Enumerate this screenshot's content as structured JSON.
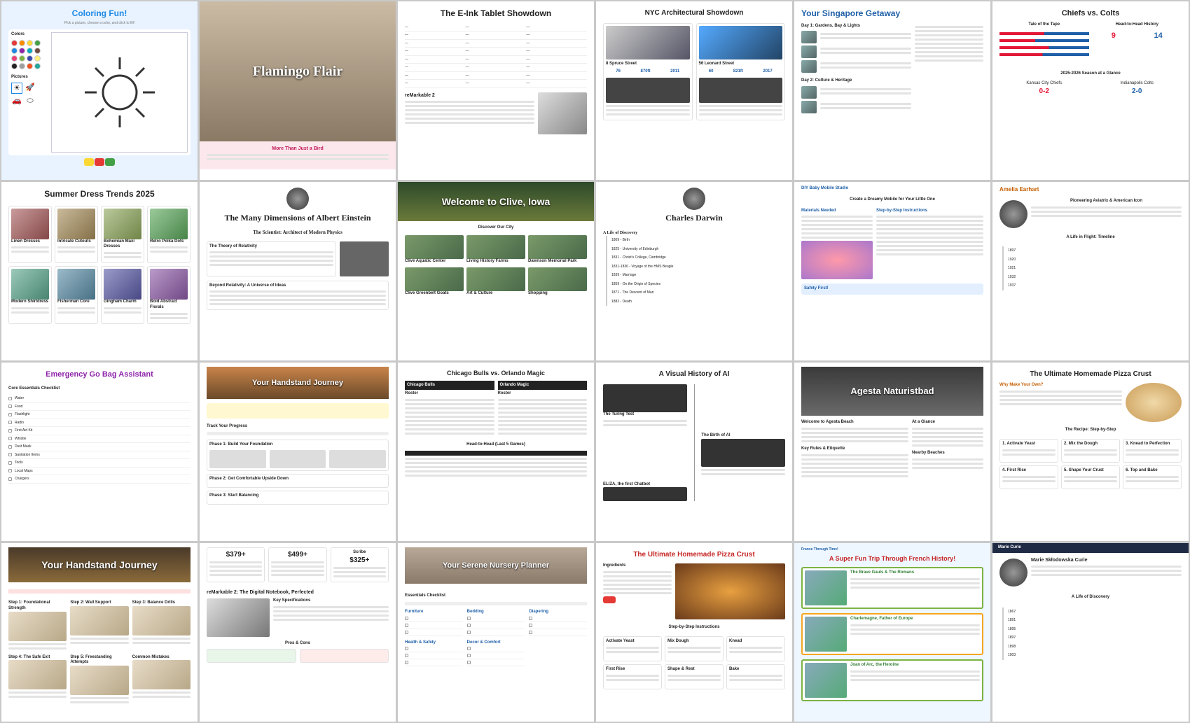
{
  "tiles": [
    {
      "title": "Coloring Fun!",
      "sub": "Pick a picture, choose a color, and click to fill!",
      "colors_label": "Colors",
      "pictures_label": "Pictures"
    },
    {
      "title": "Flamingo Flair",
      "sub": "More Than Just a Bird"
    },
    {
      "title": "The E-Ink Tablet Showdown",
      "sub": "reMarkable 2"
    },
    {
      "title": "NYC Architectural Showdown",
      "sub": "8 Spruce Street",
      "sub2": "56 Leonard Street",
      "n1": "76",
      "n2": "870ft",
      "n3": "2011",
      "n4": "60",
      "n5": "821ft",
      "n6": "2017"
    },
    {
      "title": "Your Singapore Getaway",
      "sub": "Day 1: Gardens, Bay & Lights",
      "sub2": "Day 2: Culture & Heritage"
    },
    {
      "title": "Chiefs vs. Colts",
      "sub": "Tale of the Tape",
      "sub2": "Head-to-Head History",
      "sub3": "2025-2026 Season at a Glance",
      "s1": "9",
      "s2": "14",
      "r1": "0-2",
      "r2": "2-0",
      "team1": "Kansas City Chiefs",
      "team2": "Indianapolis Colts"
    },
    {
      "title": "Summer Dress Trends 2025",
      "items": [
        "Linen Dresses",
        "Intricate Cutouts",
        "Bohemian Maxi Dresses",
        "Retro Polka Dots",
        "Modern Shirtdress",
        "Fisherman Core",
        "Gingham Charm",
        "Bold Abstract Florals"
      ]
    },
    {
      "title": "The Many Dimensions of Albert Einstein",
      "sub": "The Scientist: Architect of Modern Physics",
      "s1": "The Theory of Relativity",
      "s2": "Beyond Relativity: A Universe of Ideas"
    },
    {
      "title": "Welcome to Clive, Iowa",
      "sub": "Discover Our City",
      "items": [
        "Clive Aquatic Center",
        "Living History Farms",
        "Dawnson Memorial Park",
        "Clive Greenbelt Goats",
        "Art & Culture",
        "Shopping"
      ]
    },
    {
      "title": "Charles Darwin",
      "sub": "A Life of Discovery",
      "items": [
        "1809 - Birth",
        "1825 - University of Edinburgh",
        "1831 - Christ's College, Cambridge",
        "1831-1836 - Voyage of the HMS Beagle",
        "1839 - Marriage",
        "1859 - On the Origin of Species",
        "1871 - The Descent of Man",
        "1882 - Death"
      ]
    },
    {
      "title": "DIY Baby Mobile Studio",
      "sub": "Create a Dreamy Mobile for Your Little One",
      "s1": "Materials Needed",
      "s2": "Step-by-Step Instructions",
      "s3": "Safety First!"
    },
    {
      "title": "Amelia Earhart",
      "sub": "Pioneering Aviatrix & American Icon",
      "s1": "A Life in Flight: Timeline",
      "items": [
        "1897",
        "1920",
        "1921",
        "1932",
        "1937"
      ]
    },
    {
      "title": "Emergency Go Bag Assistant",
      "sub": "Core Essentials Checklist",
      "items": [
        "Water",
        "Food",
        "Flashlight",
        "Radio",
        "First Aid Kit",
        "Whistle",
        "Dust Mask",
        "Sanitation Items",
        "Tools",
        "Local Maps",
        "Chargers"
      ]
    },
    {
      "title": "Your Handstand Journey",
      "sub": "Track Your Progress",
      "s1": "Phase 1: Build Your Foundation",
      "s2": "Phase 2: Get Comfortable Upside Down",
      "s3": "Phase 3: Start Balancing"
    },
    {
      "title": "Chicago Bulls vs. Orlando Magic",
      "team1": "Chicago Bulls",
      "team2": "Orlando Magic",
      "s1": "Head-to-Head (Last 5 Games)",
      "roster": "Roster"
    },
    {
      "title": "A Visual History of AI",
      "s1": "The Turing Test",
      "s2": "The Birth of AI",
      "s3": "ELIZA, the first Chatbot"
    },
    {
      "title": "Agesta Naturistbad",
      "sub": "Welcome to Agesta Beach",
      "s1": "Key Rules & Etiquette",
      "s2": "At a Glance",
      "s3": "Nearby Beaches"
    },
    {
      "title": "The Ultimate Homemade Pizza Crust",
      "sub": "Why Make Your Own?",
      "s1": "The Recipe: Step-by-Step",
      "items": [
        "1. Activate Yeast",
        "2. Mix the Dough",
        "3. Knead to Perfection",
        "4. First Rise",
        "5. Shape Your Crust",
        "6. Top and Bake"
      ]
    },
    {
      "title": "Your Handstand Journey",
      "items": [
        "Step 1: Foundational Strength",
        "Step 2: Wall Support",
        "Step 3: Balance Drills",
        "Step 4: The Safe Exit",
        "Step 5: Freestanding Attempts",
        "Common Mistakes"
      ]
    },
    {
      "title": "reMarkable 2: The Digital Notebook, Perfected",
      "p1": "$379+",
      "p2": "$499+",
      "p3": "$325+",
      "scribe": "Scribe",
      "s1": "Key Specifications",
      "s2": "Pros & Cons"
    },
    {
      "title": "Your Serene Nursery Planner",
      "sub": "Essentials Checklist",
      "items": [
        "Furniture",
        "Bedding",
        "Diapering",
        "Health & Safety",
        "Decor & Comfort"
      ]
    },
    {
      "title": "The Ultimate Homemade Pizza Crust",
      "sub": "Ingredients",
      "s1": "Step-by-Step Instructions",
      "items": [
        "Activate Yeast",
        "Mix Dough",
        "Knead",
        "First Rise",
        "Shape & Rest",
        "Bake"
      ]
    },
    {
      "title": "A Super Fun Trip Through French History!",
      "nav": "France Through Time!",
      "items": [
        "The Brave Gauls & The Romans",
        "Charlemagne, Father of Europe",
        "Joan of Arc, the Heroine"
      ]
    },
    {
      "title": "Marie Curie",
      "sub": "Marie Skłodowska Curie",
      "s1": "A Life of Discovery",
      "items": [
        "1867",
        "1891",
        "1895",
        "1897",
        "1898",
        "1903"
      ]
    }
  ],
  "colors": {
    "palette": [
      "#e53935",
      "#fb8c00",
      "#fdd835",
      "#43a047",
      "#1e88e5",
      "#8e24aa",
      "#00acc1",
      "#6d4c41",
      "#ec407a",
      "#7cb342",
      "#3949ab",
      "#fff176",
      "#212121",
      "#9e9e9e",
      "#f4511e",
      "#26a69a"
    ]
  }
}
